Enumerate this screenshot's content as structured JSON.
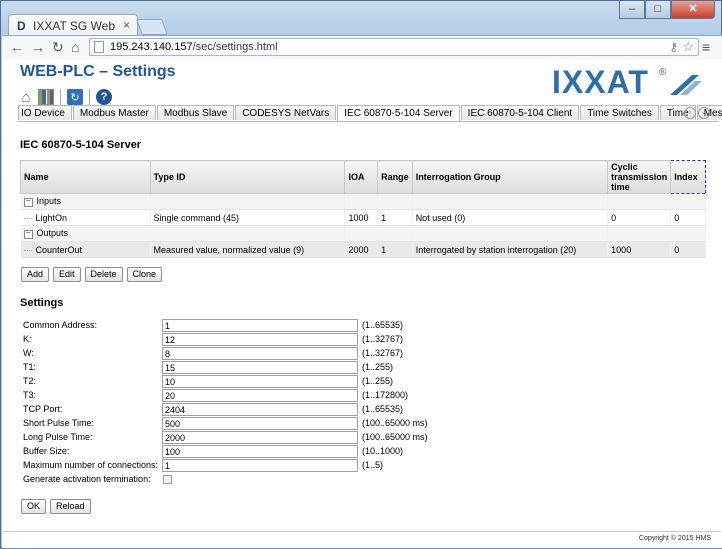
{
  "browser": {
    "tab_title": "IXXAT SG Web",
    "tab_close": "×",
    "favicon": "D",
    "url_host": "195.243.140.157",
    "url_path": "/sec/settings.html",
    "win_min": "–",
    "win_max": "□",
    "win_close": "✕"
  },
  "page": {
    "title": "WEB-PLC – Settings",
    "logo_text": "IXXAT",
    "logo_mark": "®"
  },
  "tabs": [
    {
      "label": "IO Device"
    },
    {
      "label": "Modbus Master"
    },
    {
      "label": "Modbus Slave"
    },
    {
      "label": "CODESYS NetVars"
    },
    {
      "label": "IEC 60870-5-104 Server",
      "selected": true
    },
    {
      "label": "IEC 60870-5-104 Client"
    },
    {
      "label": "Time Switches"
    },
    {
      "label": "Time"
    },
    {
      "label": "Messages"
    }
  ],
  "server": {
    "heading": "IEC 60870-5-104 Server",
    "columns": {
      "name": "Name",
      "type_id": "Type ID",
      "ioa": "IOA",
      "range": "Range",
      "group": "Interrogation Group",
      "cyclic": "Cyclic transmission time",
      "index": "Index"
    },
    "groups": [
      {
        "label": "Inputs",
        "row": {
          "name": "LightOn",
          "type_id": "Single command (45)",
          "ioa": "1000",
          "range": "1",
          "group": "Not used (0)",
          "cyclic": "0",
          "index": "0"
        }
      },
      {
        "label": "Outputs",
        "row": {
          "name": "CounterOut",
          "type_id": "Measured value, normalized value (9)",
          "ioa": "2000",
          "range": "1",
          "group": "Interrogated by station interrogation (20)",
          "cyclic": "1000",
          "index": "0"
        }
      }
    ],
    "buttons": {
      "add": "Add",
      "edit": "Edit",
      "delete": "Delete",
      "clone": "Clone"
    }
  },
  "settings": {
    "heading": "Settings",
    "fields": [
      {
        "label": "Common Address:",
        "value": "1",
        "range": "(1..65535)"
      },
      {
        "label": "K:",
        "value": "12",
        "range": "(1..32767)"
      },
      {
        "label": "W:",
        "value": "8",
        "range": "(1..32767)"
      },
      {
        "label": "T1:",
        "value": "15",
        "range": "(1..255)"
      },
      {
        "label": "T2:",
        "value": "10",
        "range": "(1..255)"
      },
      {
        "label": "T3:",
        "value": "20",
        "range": "(1..172800)"
      },
      {
        "label": "TCP Port:",
        "value": "2404",
        "range": "(1..65535)"
      },
      {
        "label": "Short Pulse Time:",
        "value": "500",
        "range": "(100..65000 ms)"
      },
      {
        "label": "Long Pulse Time:",
        "value": "2000",
        "range": "(100..65000 ms)"
      },
      {
        "label": "Buffer Size:",
        "value": "100",
        "range": "(10..1000)"
      },
      {
        "label": "Maximum number of connections:",
        "value": "1",
        "range": "(1..5)"
      }
    ],
    "checkbox_label": "Generate activation termination:",
    "checkbox_checked": false,
    "ok": "OK",
    "reload": "Reload"
  },
  "footer": {
    "copyright": "Copyright © 2015 HMS"
  }
}
